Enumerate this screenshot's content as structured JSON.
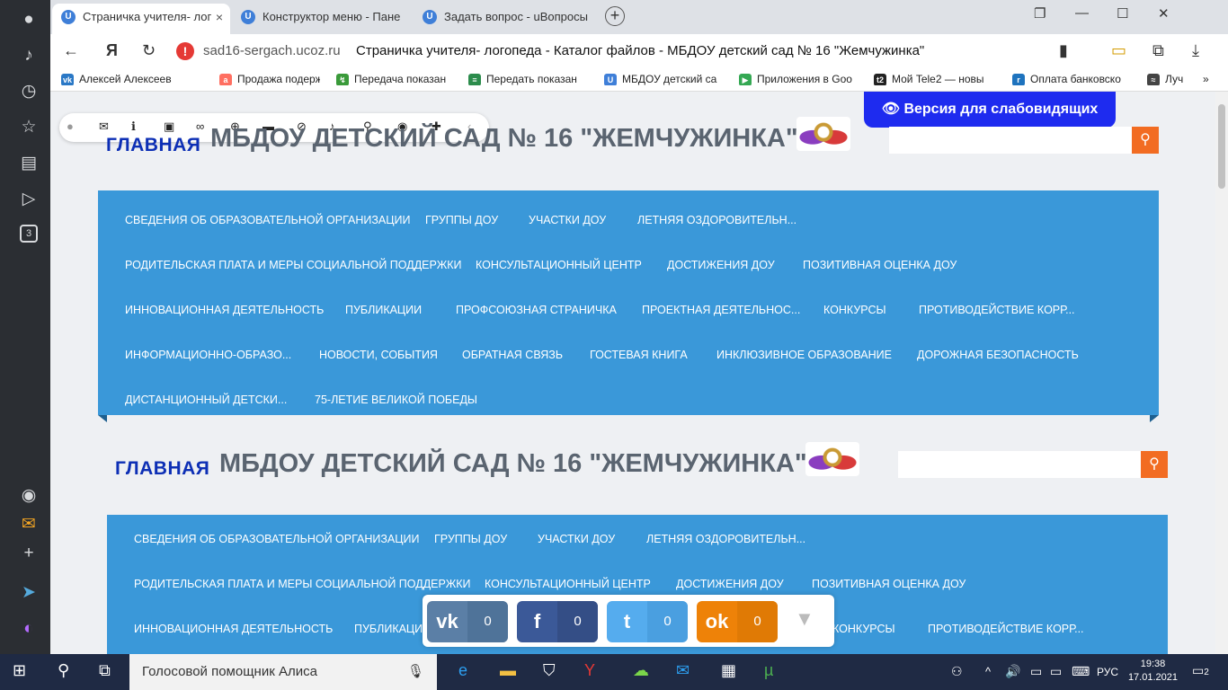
{
  "browser": {
    "tabs": [
      {
        "label": "Страничка учителя- лог",
        "active": true
      },
      {
        "label": "Конструктор меню - Пане",
        "active": false
      },
      {
        "label": "Задать вопрос - uВопросы",
        "active": false
      }
    ],
    "address": {
      "host": "sad16-sergach.ucoz.ru",
      "title": "Страничка учителя- логопеда - Каталог файлов - МБДОУ детский сад № 16 \"Жемчужинка\""
    },
    "bookmarks": [
      "Алексей Алексеев",
      "Продажа подержа",
      "Передача показан",
      "Передать показан",
      "МБДОУ детский са",
      "Приложения в Goo",
      "Мой Tele2 — новы",
      "Оплата банковско",
      "Луч"
    ]
  },
  "page": {
    "accessibility_button": "Версия для слабовидящих",
    "home_label": "ГЛАВНАЯ",
    "site_title": "МБДОУ ДЕТСКИЙ САД № 16 \"ЖЕМЧУЖИНКА\"",
    "search_placeholder": "",
    "menu": [
      "Сведения об образовательной организации",
      "Группы ДОУ",
      "Участки ДОУ",
      "Летняя оздоровительн...",
      "Родительская плата и меры социальной поддержки",
      "Консультационный центр",
      "Достижения ДОУ",
      "Позитивная оценка ДОУ",
      "Инновационная деятельность",
      "Публикации",
      "Профсоюзная страничка",
      "Проектная деятельнос...",
      "Конкурсы",
      "Противодействие корр...",
      "Информационно-образо...",
      "Новости, события",
      "Обратная связь",
      "Гостевая книга",
      "Инклюзивное образование",
      "Дорожная безопасность",
      "Дистанционный детски...",
      "75-летие Великой Победы"
    ],
    "menu2_partial": {
      "publications": "Публикаци",
      "contests": "Конкурсы"
    },
    "share": [
      {
        "network": "vk",
        "icon": "vk",
        "count": "0",
        "color": "#5b7fa6"
      },
      {
        "network": "facebook",
        "icon": "f",
        "count": "0",
        "color": "#3b5998"
      },
      {
        "network": "twitter",
        "icon": "t",
        "count": "0",
        "color": "#55acee"
      },
      {
        "network": "odnoklassniki",
        "icon": "ok",
        "count": "0",
        "color": "#ee8208"
      }
    ]
  },
  "taskbar": {
    "search_text": "Голосовой помощник Алиса",
    "lang": "РУС",
    "time": "19:38",
    "date": "17.01.2021",
    "notifications": "2"
  }
}
